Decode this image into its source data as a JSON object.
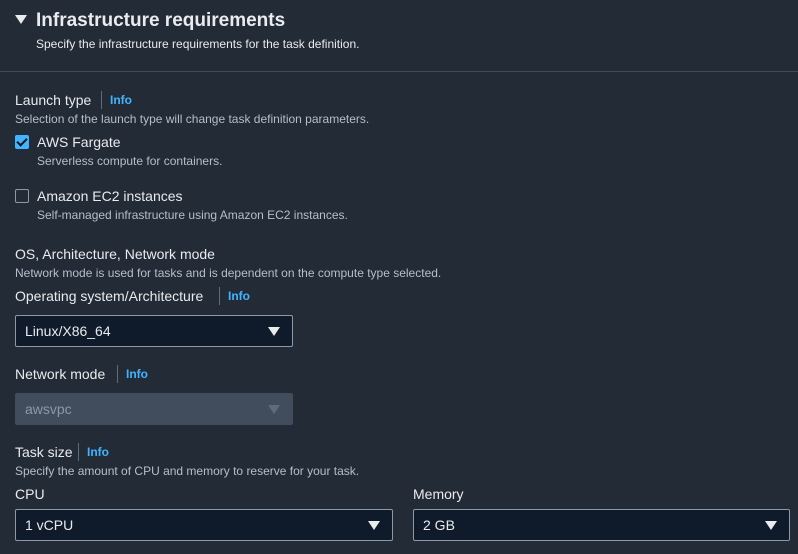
{
  "header": {
    "title": "Infrastructure requirements",
    "subtitle": "Specify the infrastructure requirements for the task definition."
  },
  "info_label": "Info",
  "launch_type": {
    "label": "Launch type",
    "description": "Selection of the launch type will change task definition parameters.",
    "options": [
      {
        "label": "AWS Fargate",
        "description": "Serverless compute for containers.",
        "checked": true
      },
      {
        "label": "Amazon EC2 instances",
        "description": "Self-managed infrastructure using Amazon EC2 instances.",
        "checked": false
      }
    ]
  },
  "os_section": {
    "heading": "OS, Architecture, Network mode",
    "description": "Network mode is used for tasks and is dependent on the compute type selected."
  },
  "os_arch": {
    "label": "Operating system/Architecture",
    "value": "Linux/X86_64"
  },
  "network_mode": {
    "label": "Network mode",
    "value": "awsvpc",
    "disabled": true
  },
  "task_size": {
    "label": "Task size",
    "description": "Specify the amount of CPU and memory to reserve for your task.",
    "cpu": {
      "label": "CPU",
      "value": "1 vCPU"
    },
    "memory": {
      "label": "Memory",
      "value": "2 GB"
    }
  },
  "colors": {
    "background": "#232b37",
    "accent": "#42b4ff",
    "text": "#e9ebed",
    "muted": "#b6bec9"
  }
}
